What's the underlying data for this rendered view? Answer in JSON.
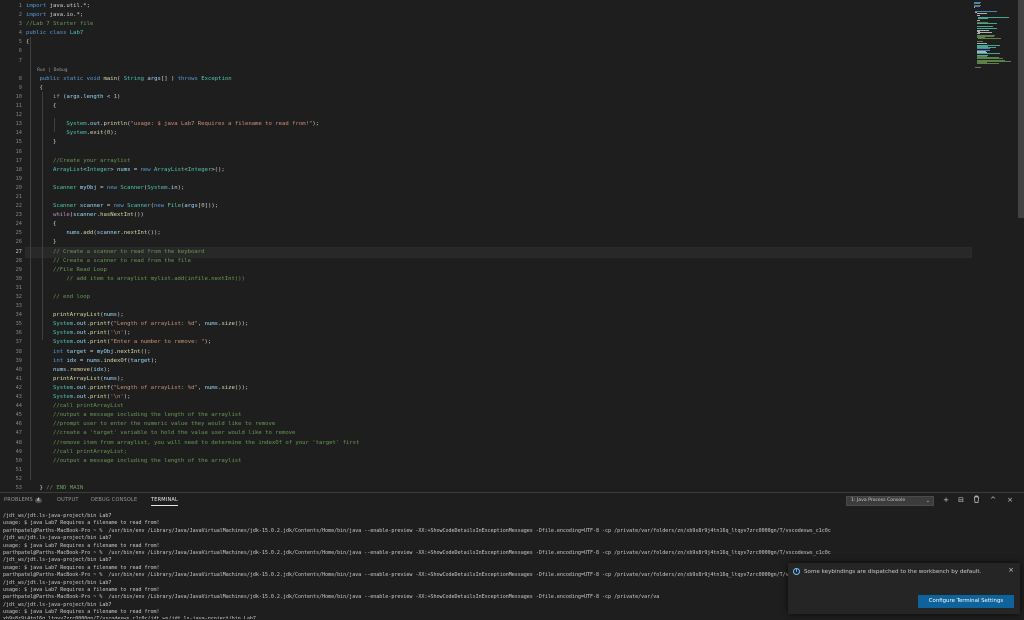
{
  "editor": {
    "start_line": 1,
    "active_line": 27,
    "code_lens": "Run | Debug",
    "lines": [
      [
        [
          "kw",
          "import"
        ],
        [
          "pl",
          " java.util.*;"
        ]
      ],
      [
        [
          "kw",
          "import"
        ],
        [
          "pl",
          " java.io.*;"
        ]
      ],
      [
        [
          "cm",
          "//Lab 7 Starter file"
        ]
      ],
      [
        [
          "kw",
          "public"
        ],
        [
          "pl",
          " "
        ],
        [
          "kw",
          "class"
        ],
        [
          "pl",
          " "
        ],
        [
          "ty",
          "Lab7"
        ]
      ],
      [
        [
          "pl",
          "{"
        ]
      ],
      [],
      [],
      [
        [
          "pl",
          "    "
        ],
        [
          "kw",
          "public"
        ],
        [
          "pl",
          " "
        ],
        [
          "kw",
          "static"
        ],
        [
          "pl",
          " "
        ],
        [
          "kw",
          "void"
        ],
        [
          "pl",
          " "
        ],
        [
          "fn",
          "main"
        ],
        [
          "pl",
          "( "
        ],
        [
          "ty",
          "String"
        ],
        [
          "pl",
          " "
        ],
        [
          "va",
          "args"
        ],
        [
          "pl",
          "[] ) "
        ],
        [
          "kw",
          "throws"
        ],
        [
          "pl",
          " "
        ],
        [
          "ty",
          "Exception"
        ]
      ],
      [
        [
          "pl",
          "    {"
        ]
      ],
      [
        [
          "pl",
          "        "
        ],
        [
          "ctl",
          "if"
        ],
        [
          "pl",
          " ("
        ],
        [
          "va",
          "args"
        ],
        [
          "pl",
          "."
        ],
        [
          "va",
          "length"
        ],
        [
          "pl",
          " < "
        ],
        [
          "nu",
          "1"
        ],
        [
          "pl",
          ")"
        ]
      ],
      [
        [
          "pl",
          "        {"
        ]
      ],
      [],
      [
        [
          "pl",
          "            "
        ],
        [
          "ty",
          "System"
        ],
        [
          "pl",
          "."
        ],
        [
          "va",
          "out"
        ],
        [
          "pl",
          "."
        ],
        [
          "fn",
          "println"
        ],
        [
          "pl",
          "("
        ],
        [
          "st",
          "\"usage: $ java Lab7 Requires a filename to read from!\""
        ],
        [
          "pl",
          ");"
        ]
      ],
      [
        [
          "pl",
          "            "
        ],
        [
          "ty",
          "System"
        ],
        [
          "pl",
          "."
        ],
        [
          "fn",
          "exit"
        ],
        [
          "pl",
          "("
        ],
        [
          "nu",
          "0"
        ],
        [
          "pl",
          ");"
        ]
      ],
      [
        [
          "pl",
          "        }"
        ]
      ],
      [],
      [
        [
          "pl",
          "        "
        ],
        [
          "cm",
          "//Create your arraylist"
        ]
      ],
      [
        [
          "pl",
          "        "
        ],
        [
          "ty",
          "ArrayList"
        ],
        [
          "pl",
          "<"
        ],
        [
          "ty",
          "Integer"
        ],
        [
          "pl",
          "> "
        ],
        [
          "va",
          "nums"
        ],
        [
          "pl",
          " = "
        ],
        [
          "kw",
          "new"
        ],
        [
          "pl",
          " "
        ],
        [
          "ty",
          "ArrayList"
        ],
        [
          "pl",
          "<"
        ],
        [
          "ty",
          "Integer"
        ],
        [
          "pl",
          ">();"
        ]
      ],
      [],
      [
        [
          "pl",
          "        "
        ],
        [
          "ty",
          "Scanner"
        ],
        [
          "pl",
          " "
        ],
        [
          "va",
          "myObj"
        ],
        [
          "pl",
          " = "
        ],
        [
          "kw",
          "new"
        ],
        [
          "pl",
          " "
        ],
        [
          "ty",
          "Scanner"
        ],
        [
          "pl",
          "("
        ],
        [
          "ty",
          "System"
        ],
        [
          "pl",
          "."
        ],
        [
          "va",
          "in"
        ],
        [
          "pl",
          ");"
        ]
      ],
      [],
      [
        [
          "pl",
          "        "
        ],
        [
          "ty",
          "Scanner"
        ],
        [
          "pl",
          " "
        ],
        [
          "va",
          "scanner"
        ],
        [
          "pl",
          " = "
        ],
        [
          "kw",
          "new"
        ],
        [
          "pl",
          " "
        ],
        [
          "ty",
          "Scanner"
        ],
        [
          "pl",
          "("
        ],
        [
          "kw",
          "new"
        ],
        [
          "pl",
          " "
        ],
        [
          "ty",
          "File"
        ],
        [
          "pl",
          "("
        ],
        [
          "va",
          "args"
        ],
        [
          "pl",
          "["
        ],
        [
          "nu",
          "0"
        ],
        [
          "pl",
          "]));"
        ]
      ],
      [
        [
          "pl",
          "        "
        ],
        [
          "ctl",
          "while"
        ],
        [
          "pl",
          "("
        ],
        [
          "va",
          "scanner"
        ],
        [
          "pl",
          "."
        ],
        [
          "fn",
          "hasNextInt"
        ],
        [
          "pl",
          "())"
        ]
      ],
      [
        [
          "pl",
          "        {"
        ]
      ],
      [
        [
          "pl",
          "            "
        ],
        [
          "va",
          "nums"
        ],
        [
          "pl",
          "."
        ],
        [
          "fn",
          "add"
        ],
        [
          "pl",
          "("
        ],
        [
          "va",
          "scanner"
        ],
        [
          "pl",
          "."
        ],
        [
          "fn",
          "nextInt"
        ],
        [
          "pl",
          "());"
        ]
      ],
      [
        [
          "pl",
          "        }"
        ]
      ],
      [
        [
          "pl",
          "        "
        ],
        [
          "cm",
          "// Create a scanner to read from the keyboard"
        ]
      ],
      [
        [
          "pl",
          "        "
        ],
        [
          "cm",
          "// Create a scanner to read from the file"
        ]
      ],
      [
        [
          "pl",
          "        "
        ],
        [
          "cm",
          "//File Read Loop"
        ]
      ],
      [
        [
          "pl",
          "            "
        ],
        [
          "cm",
          "// add item to arraylist mylist.add(infile.nextInt())"
        ]
      ],
      [],
      [
        [
          "pl",
          "        "
        ],
        [
          "cm",
          "// end loop"
        ]
      ],
      [],
      [
        [
          "pl",
          "        "
        ],
        [
          "fn",
          "printArrayList"
        ],
        [
          "pl",
          "("
        ],
        [
          "va",
          "nums"
        ],
        [
          "pl",
          ");"
        ]
      ],
      [
        [
          "pl",
          "        "
        ],
        [
          "ty",
          "System"
        ],
        [
          "pl",
          "."
        ],
        [
          "va",
          "out"
        ],
        [
          "pl",
          "."
        ],
        [
          "fn",
          "printf"
        ],
        [
          "pl",
          "("
        ],
        [
          "st",
          "\"Length of arrayList: %d\""
        ],
        [
          "pl",
          ", "
        ],
        [
          "va",
          "nums"
        ],
        [
          "pl",
          "."
        ],
        [
          "fn",
          "size"
        ],
        [
          "pl",
          "());"
        ]
      ],
      [
        [
          "pl",
          "        "
        ],
        [
          "ty",
          "System"
        ],
        [
          "pl",
          "."
        ],
        [
          "va",
          "out"
        ],
        [
          "pl",
          "."
        ],
        [
          "fn",
          "print"
        ],
        [
          "pl",
          "("
        ],
        [
          "st",
          "'\\n'"
        ],
        [
          "pl",
          ");"
        ]
      ],
      [
        [
          "pl",
          "        "
        ],
        [
          "ty",
          "System"
        ],
        [
          "pl",
          "."
        ],
        [
          "va",
          "out"
        ],
        [
          "pl",
          "."
        ],
        [
          "fn",
          "print"
        ],
        [
          "pl",
          "("
        ],
        [
          "st",
          "\"Enter a number to remove: \""
        ],
        [
          "pl",
          ");"
        ]
      ],
      [
        [
          "pl",
          "        "
        ],
        [
          "kw",
          "int"
        ],
        [
          "pl",
          " "
        ],
        [
          "va",
          "target"
        ],
        [
          "pl",
          " = "
        ],
        [
          "va",
          "myObj"
        ],
        [
          "pl",
          "."
        ],
        [
          "fn",
          "nextInt"
        ],
        [
          "pl",
          "();"
        ]
      ],
      [
        [
          "pl",
          "        "
        ],
        [
          "kw",
          "int"
        ],
        [
          "pl",
          " "
        ],
        [
          "va",
          "idx"
        ],
        [
          "pl",
          " = "
        ],
        [
          "va",
          "nums"
        ],
        [
          "pl",
          "."
        ],
        [
          "fn",
          "indexOf"
        ],
        [
          "pl",
          "("
        ],
        [
          "va",
          "target"
        ],
        [
          "pl",
          ");"
        ]
      ],
      [
        [
          "pl",
          "        "
        ],
        [
          "va",
          "nums"
        ],
        [
          "pl",
          "."
        ],
        [
          "fn",
          "remove"
        ],
        [
          "pl",
          "("
        ],
        [
          "va",
          "idx"
        ],
        [
          "pl",
          ");"
        ]
      ],
      [
        [
          "pl",
          "        "
        ],
        [
          "fn",
          "printArrayList"
        ],
        [
          "pl",
          "("
        ],
        [
          "va",
          "nums"
        ],
        [
          "pl",
          ");"
        ]
      ],
      [
        [
          "pl",
          "        "
        ],
        [
          "ty",
          "System"
        ],
        [
          "pl",
          "."
        ],
        [
          "va",
          "out"
        ],
        [
          "pl",
          "."
        ],
        [
          "fn",
          "printf"
        ],
        [
          "pl",
          "("
        ],
        [
          "st",
          "\"Length of arrayList: %d\""
        ],
        [
          "pl",
          ", "
        ],
        [
          "va",
          "nums"
        ],
        [
          "pl",
          "."
        ],
        [
          "fn",
          "size"
        ],
        [
          "pl",
          "());"
        ]
      ],
      [
        [
          "pl",
          "        "
        ],
        [
          "ty",
          "System"
        ],
        [
          "pl",
          "."
        ],
        [
          "va",
          "out"
        ],
        [
          "pl",
          "."
        ],
        [
          "fn",
          "print"
        ],
        [
          "pl",
          "("
        ],
        [
          "st",
          "'\\n'"
        ],
        [
          "pl",
          ");"
        ]
      ],
      [
        [
          "pl",
          "        "
        ],
        [
          "cm",
          "//call printArrayList"
        ]
      ],
      [
        [
          "pl",
          "        "
        ],
        [
          "cm",
          "//output a message including the length of the arraylist"
        ]
      ],
      [
        [
          "pl",
          "        "
        ],
        [
          "cm",
          "//prompt user to enter the numeric value they would like to remove"
        ]
      ],
      [
        [
          "pl",
          "        "
        ],
        [
          "cm",
          "//create a 'target' variable to hold the value user would like to remove"
        ]
      ],
      [
        [
          "pl",
          "        "
        ],
        [
          "cm",
          "//remove item from arraylist, you will need to determine the indexOf of your 'target' first"
        ]
      ],
      [
        [
          "pl",
          "        "
        ],
        [
          "cm",
          "//call printArrayList;"
        ]
      ],
      [
        [
          "pl",
          "        "
        ],
        [
          "cm",
          "//output a message including the length of the arraylist"
        ]
      ],
      [],
      [],
      [
        [
          "pl",
          "    } "
        ],
        [
          "cm",
          "// END MAIN"
        ]
      ]
    ]
  },
  "panel": {
    "tabs": {
      "problems": "PROBLEMS",
      "problems_count": "4",
      "output": "OUTPUT",
      "debug_console": "DEBUG CONSOLE",
      "terminal": "TERMINAL"
    },
    "terminal_select": "1: Java Process Console",
    "icons": {
      "add": "+",
      "split": "⊟",
      "trash": "🗑",
      "maximize": "^",
      "close": "×"
    }
  },
  "terminal": {
    "lines": [
      "/jdt_ws/jdt.ls-java-project/bin Lab7",
      "usage: $ java Lab7 Requires a filename to read from!",
      "parthpatel@Parths-MacBook-Pro ~ %  /usr/bin/env /Library/Java/JavaVirtualMachines/jdk-15.0.2.jdk/Contents/Home/bin/java --enable-preview -XX:+ShowCodeDetailsInExceptionMessages -Dfile.encoding=UTF-8 -cp /private/var/folders/zn/xb9s8r9j4tn16q_ltqyv7zrc0000gn/T/vscodesws_c1c0c",
      "/jdt_ws/jdt.ls-java-project/bin Lab7",
      "usage: $ java Lab7 Requires a filename to read from!",
      "parthpatel@Parths-MacBook-Pro ~ %  /usr/bin/env /Library/Java/JavaVirtualMachines/jdk-15.0.2.jdk/Contents/Home/bin/java --enable-preview -XX:+ShowCodeDetailsInExceptionMessages -Dfile.encoding=UTF-8 -cp /private/var/folders/zn/xb9s8r9j4tn16q_ltqyv7zrc0000gn/T/vscodesws_c1c0c",
      "/jdt_ws/jdt.ls-java-project/bin Lab7",
      "usage: $ java Lab7 Requires a filename to read from!",
      "parthpatel@Parths-MacBook-Pro ~ %  /usr/bin/env /Library/Java/JavaVirtualMachines/jdk-15.0.2.jdk/Contents/Home/bin/java --enable-preview -XX:+ShowCodeDetailsInExceptionMessages -Dfile.encoding=UTF-8 -cp /private/var/folders/zn/xb9s8r9j4tn16q_ltqyv7zrc0000gn/T/vscodesws_c1c0c",
      "/jdt_ws/jdt.ls-java-project/bin Lab7",
      "usage: $ java Lab7 Requires a filename to read from!",
      "parthpatel@Parths-MacBook-Pro ~ %  /usr/bin/env /Library/Java/JavaVirtualMachines/jdk-15.0.2.jdk/Contents/Home/bin/java --enable-preview -XX:+ShowCodeDetailsInExceptionMessages -Dfile.encoding=UTF-8 -cp /private/var/va",
      "/jdt_ws/jdt.ls-java-project/bin Lab7",
      "usage: $ java Lab7 Requires a filename to read from!",
      "xb9s8r9j4tn16q_ltqyv7zrc0000gn/T/vscodesws_c1c0c/jdt_ws/jdt.ls-java-project/bin Lab7",
      "usage: $ java Lab7 Requires a filename to read from!"
    ],
    "prompt": "parthpatel@Parths-MacBook-Pro ~ % "
  },
  "notification": {
    "message": "Some keybindings are dispatched to the workbench by default.",
    "button": "Configure Terminal Settings",
    "close": "×",
    "icon": "i"
  },
  "colors": {
    "editor_bg": "#1e1e1e",
    "keyword": "#569cd6",
    "control": "#c586c0",
    "type": "#4ec9b0",
    "function": "#dcdcaa",
    "string": "#ce9178",
    "number": "#b5cea8",
    "comment": "#6a9955",
    "variable": "#9cdcfe",
    "button": "#0e639c",
    "info": "#75beff"
  }
}
